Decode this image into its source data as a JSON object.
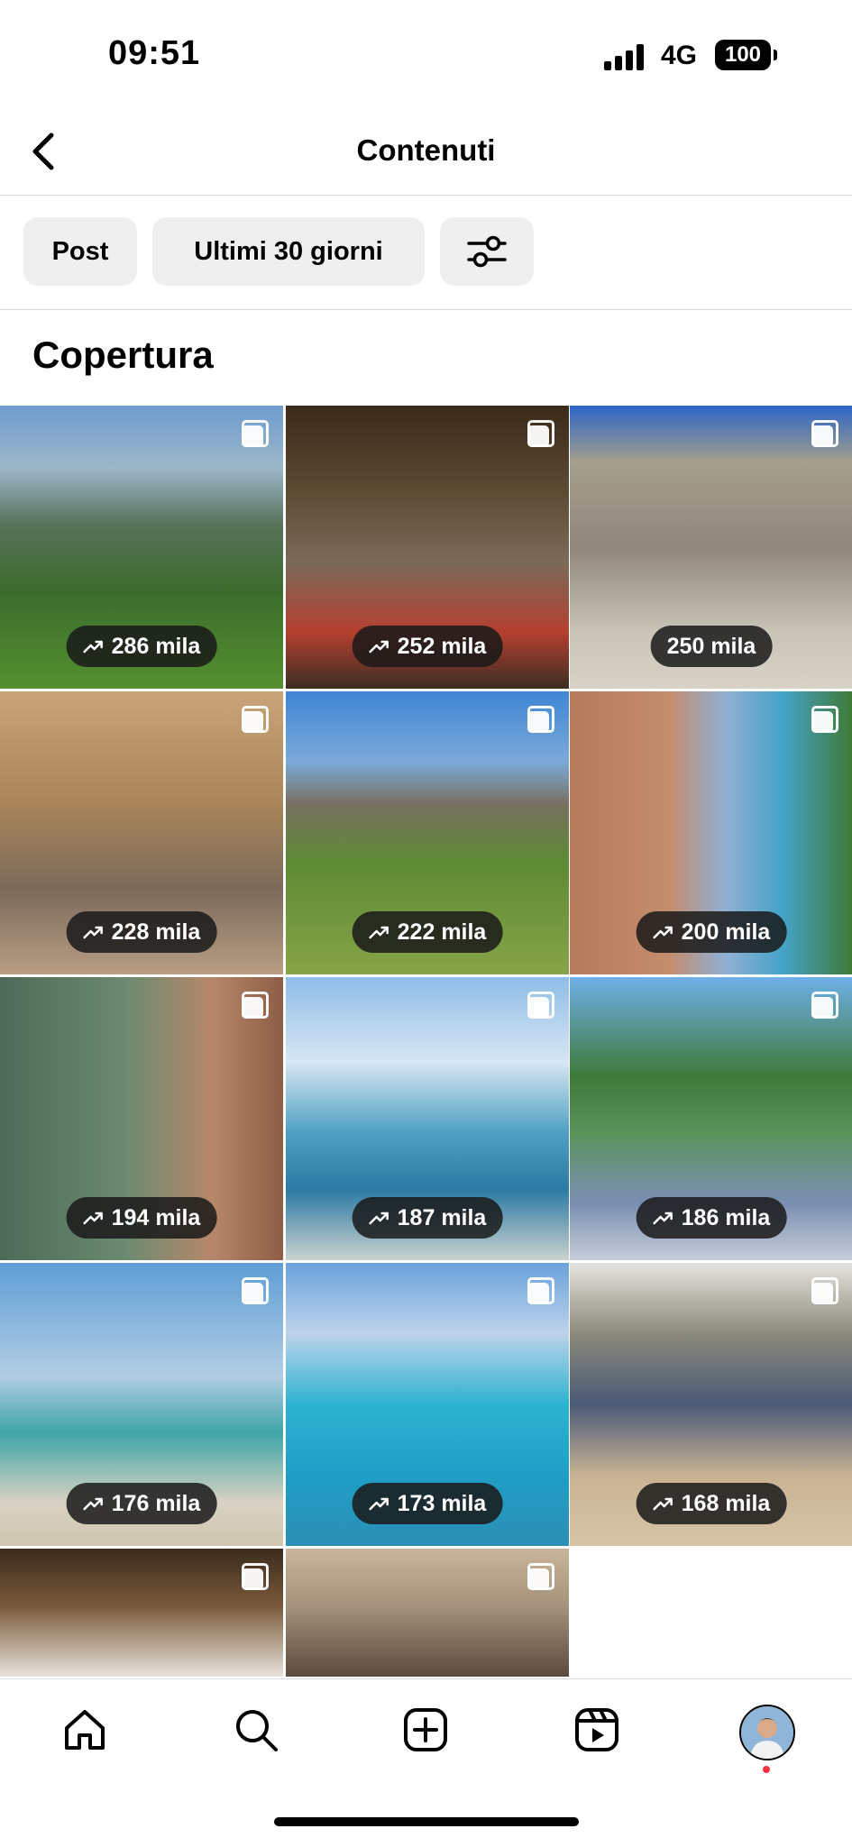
{
  "status": {
    "time": "09:51",
    "network": "4G",
    "battery": "100"
  },
  "header": {
    "title": "Contenuti"
  },
  "filters": {
    "type_label": "Post",
    "range_label": "Ultimi 30 giorni"
  },
  "section": {
    "title": "Copertura"
  },
  "posts": [
    {
      "reach": "286 mila",
      "trend_icon": true
    },
    {
      "reach": "252 mila",
      "trend_icon": true
    },
    {
      "reach": "250 mila",
      "trend_icon": false
    },
    {
      "reach": "228 mila",
      "trend_icon": true
    },
    {
      "reach": "222 mila",
      "trend_icon": true
    },
    {
      "reach": "200 mila",
      "trend_icon": true
    },
    {
      "reach": "194 mila",
      "trend_icon": true
    },
    {
      "reach": "187 mila",
      "trend_icon": true
    },
    {
      "reach": "186 mila",
      "trend_icon": true
    },
    {
      "reach": "176 mila",
      "trend_icon": true
    },
    {
      "reach": "173 mila",
      "trend_icon": true
    },
    {
      "reach": "168 mila",
      "trend_icon": true
    },
    {
      "reach": "",
      "trend_icon": false
    },
    {
      "reach": "",
      "trend_icon": false
    }
  ],
  "tabs": [
    "home-icon",
    "search-icon",
    "create-icon",
    "reels-icon",
    "profile-avatar"
  ]
}
